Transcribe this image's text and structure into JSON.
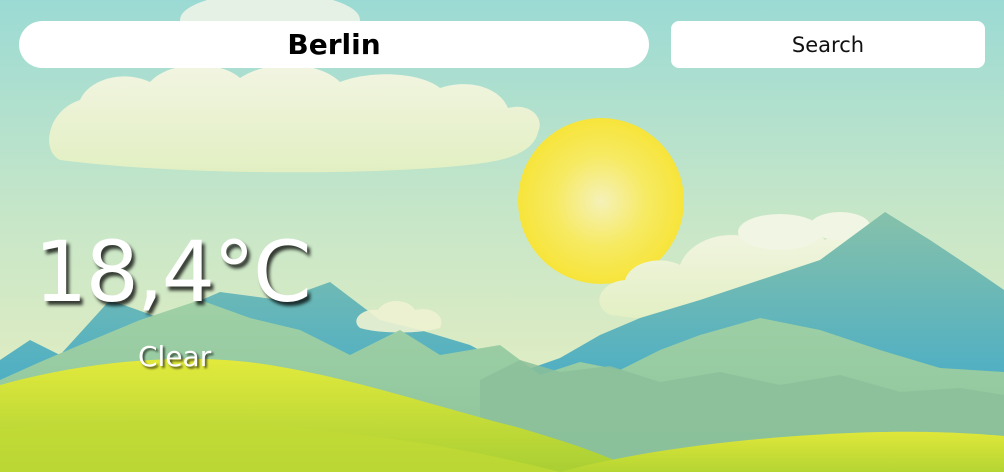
{
  "search": {
    "city_value": "Berlin",
    "button_label": "Search"
  },
  "weather": {
    "temperature": "18,4°C",
    "condition": "Clear"
  },
  "colors": {
    "sky_top": "#9fdcd4",
    "sky_bottom": "#e6efc4",
    "sun": "#f7e84a",
    "cloud": "#eef2d6",
    "mountain_blue": "#44aec8",
    "mountain_green": "#8cc4a0",
    "grass": "#b3d434"
  },
  "icons": {
    "sun": "sun-icon",
    "cloud": "cloud-icon"
  }
}
